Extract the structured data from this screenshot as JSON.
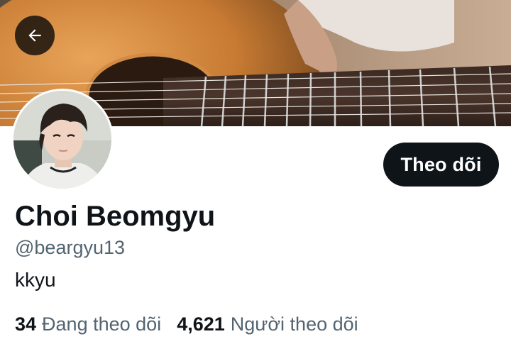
{
  "profile": {
    "display_name": "Choi Beomgyu",
    "handle": "@beargyu13",
    "bio": "kkyu",
    "follow_label": "Theo dõi",
    "following_count": "34",
    "following_label": "Đang theo dõi",
    "followers_count": "4,621",
    "followers_label": "Người theo dõi"
  },
  "icons": {
    "back": "arrow-left-icon"
  },
  "colors": {
    "text_primary": "#0f1419",
    "text_secondary": "#536471",
    "button_bg": "#0f1419",
    "button_text": "#ffffff"
  }
}
